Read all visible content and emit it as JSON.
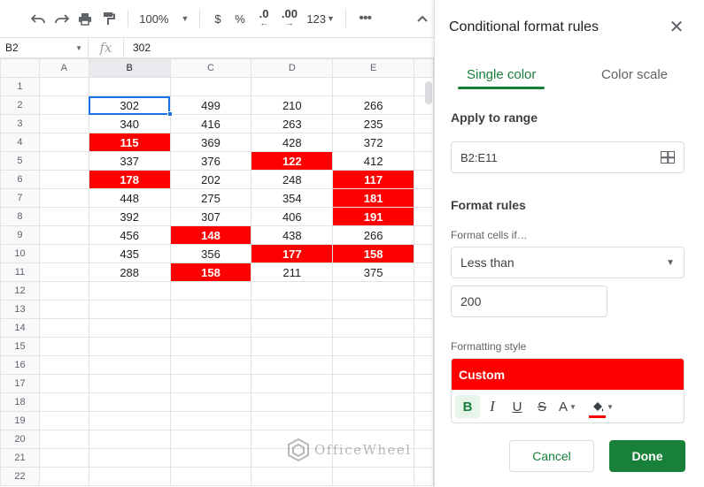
{
  "toolbar": {
    "zoom": "100%",
    "currency": "$",
    "percent": "%",
    "dec_decrease": ".0",
    "dec_increase": ".00",
    "number_format": "123"
  },
  "formula_bar": {
    "cell_ref": "B2",
    "fx_label": "fx",
    "value": "302"
  },
  "sheet": {
    "columns": [
      "A",
      "B",
      "C",
      "D",
      "E"
    ],
    "rows": [
      "1",
      "2",
      "3",
      "4",
      "5",
      "6",
      "7",
      "8",
      "9",
      "10",
      "11",
      "12",
      "13",
      "14",
      "15",
      "16",
      "17",
      "18",
      "19",
      "20",
      "21",
      "22"
    ],
    "data": [
      [
        "302",
        "499",
        "210",
        "266"
      ],
      [
        "340",
        "416",
        "263",
        "235"
      ],
      [
        "115",
        "369",
        "428",
        "372"
      ],
      [
        "337",
        "376",
        "122",
        "412"
      ],
      [
        "178",
        "202",
        "248",
        "117"
      ],
      [
        "448",
        "275",
        "354",
        "181"
      ],
      [
        "392",
        "307",
        "406",
        "191"
      ],
      [
        "456",
        "148",
        "438",
        "266"
      ],
      [
        "435",
        "356",
        "177",
        "158"
      ],
      [
        "288",
        "158",
        "211",
        "375"
      ]
    ],
    "highlight_color": "#ff0000"
  },
  "watermark": "OfficeWheel",
  "panel": {
    "title": "Conditional format rules",
    "tabs": [
      "Single color",
      "Color scale"
    ],
    "apply_range_title": "Apply to range",
    "range_value": "B2:E11",
    "format_rules_title": "Format rules",
    "format_cells_if_label": "Format cells if…",
    "condition": "Less than",
    "condition_value": "200",
    "formatting_style_label": "Formatting style",
    "style_preview": "Custom",
    "style_tools": [
      "B",
      "I",
      "U",
      "S",
      "A"
    ],
    "cancel_label": "Cancel",
    "done_label": "Done",
    "accent_color": "#188038"
  }
}
